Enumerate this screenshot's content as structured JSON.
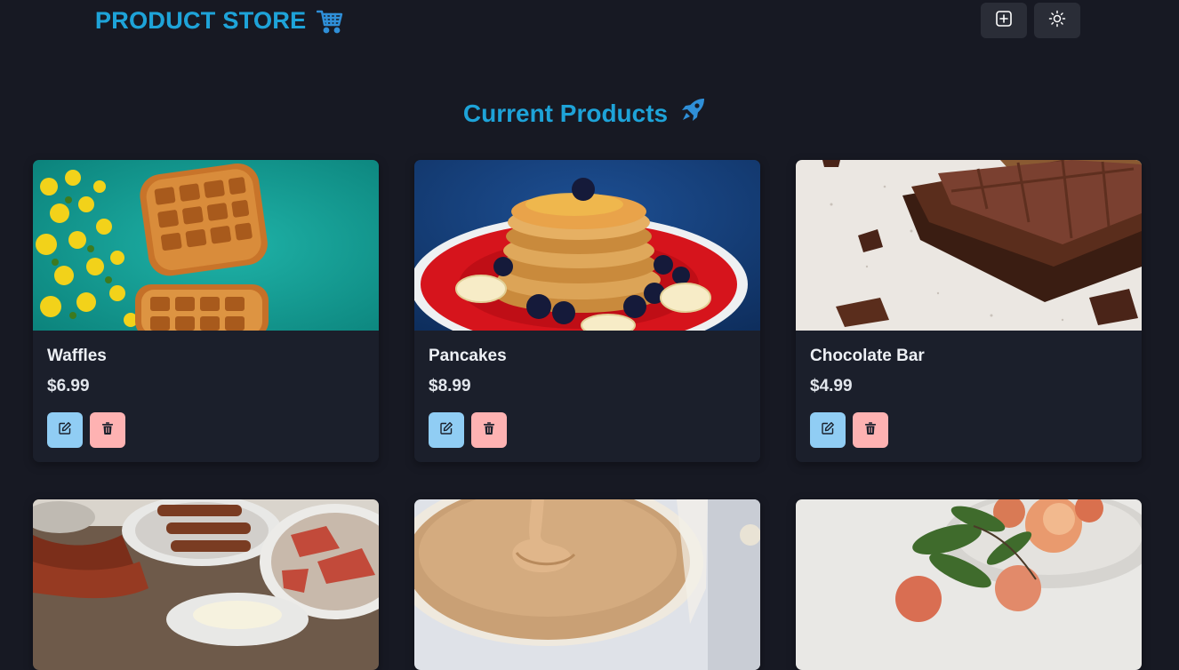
{
  "navbar": {
    "brand": "PRODUCT STORE",
    "brand_icon": "shopping-cart-icon",
    "add_icon": "plus-square-icon",
    "theme_icon": "sun-icon"
  },
  "main": {
    "title": "Current Products",
    "title_icon": "rocket-icon"
  },
  "products": [
    {
      "name": "Waffles",
      "price": "$6.99"
    },
    {
      "name": "Pancakes",
      "price": "$8.99"
    },
    {
      "name": "Chocolate Bar",
      "price": "$4.99"
    },
    {
      "name": "",
      "price": ""
    },
    {
      "name": "",
      "price": ""
    },
    {
      "name": "",
      "price": ""
    }
  ],
  "colors": {
    "background": "#171923",
    "card": "#1b1f2b",
    "accent": "#1ea3d8",
    "edit_button": "#90cdf4",
    "delete_button": "#feb2b2"
  }
}
